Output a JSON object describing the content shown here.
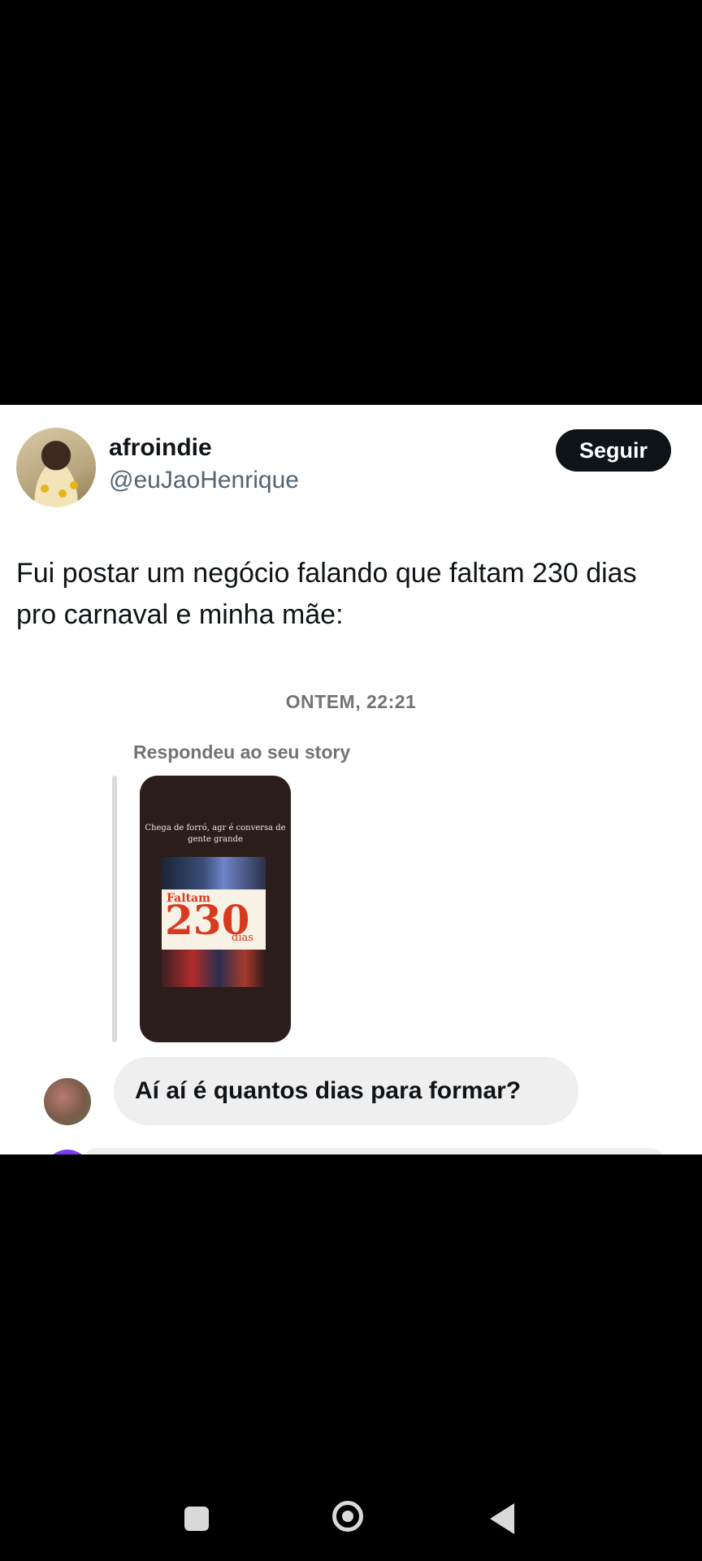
{
  "tweet": {
    "display_name": "afroindie",
    "handle": "@euJaoHenrique",
    "follow_label": "Seguir",
    "text": "Fui postar um negócio falando que faltam 230 dias pro carnaval e minha mãe:"
  },
  "chat": {
    "timestamp": "ONTEM, 22:21",
    "replied_label": "Respondeu ao seu story",
    "story": {
      "caption": "Chega de forró, agr é conversa de gente grande",
      "poster_word": "Faltam",
      "poster_number": "230",
      "poster_unit": "dias"
    },
    "message": "Aí aí é quantos dias para formar?"
  },
  "nav": {
    "icons": [
      "recent-apps-icon",
      "home-icon",
      "back-icon"
    ]
  },
  "colors": {
    "follow_button_bg": "#0f1419",
    "handle_gray": "#536471",
    "bubble_bg": "#efefef",
    "poster_red": "#d83a1f"
  }
}
